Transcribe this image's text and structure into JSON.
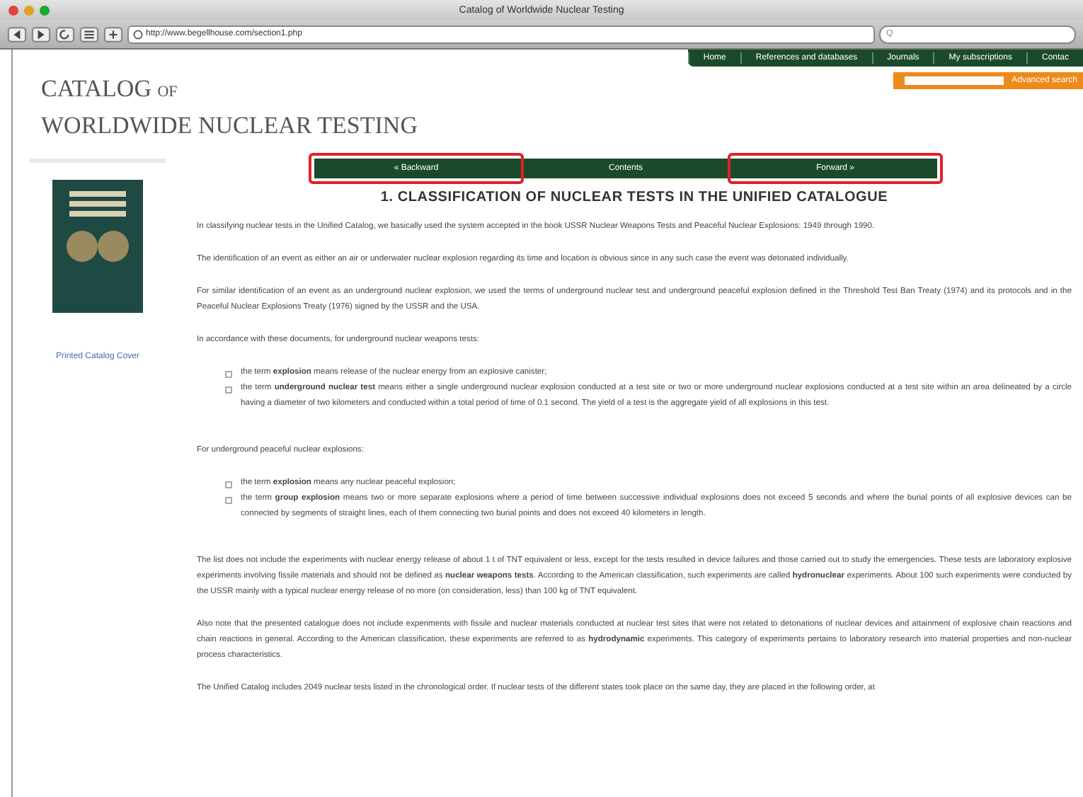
{
  "window": {
    "title": "Catalog of Worldwide Nuclear Testing"
  },
  "address_bar": {
    "value": "http://www.begellhouse.com/section1.php"
  },
  "search_bar": {
    "placeholder": "Q"
  },
  "top_nav": [
    {
      "label": "Home"
    },
    {
      "label": "References and databases"
    },
    {
      "label": "Journals"
    },
    {
      "label": "My subscriptions"
    },
    {
      "label": "Contac"
    }
  ],
  "site_search": {
    "button": "Advanced search"
  },
  "logo": {
    "line1": "CATALOG",
    "small": "OF",
    "line2": "WORLDWIDE NUCLEAR TESTING"
  },
  "sidebar": {
    "cover_link": "Printed Catalog Cover"
  },
  "pager": [
    {
      "label": "« Backward",
      "highlighted": true
    },
    {
      "label": "Contents",
      "highlighted": false
    },
    {
      "label": "Forward »",
      "highlighted": true
    }
  ],
  "heading": "1. CLASSIFICATION OF NUCLEAR TESTS IN THE UNIFIED CATALOGUE",
  "content": [
    {
      "kind": "paragraph",
      "text": "In classifying nuclear tests in the Unified Catalog, we basically used the system accepted in the book USSR Nuclear Weapons Tests and Peaceful Nuclear Explosions: 1949 through 1990."
    },
    {
      "kind": "paragraph",
      "text": "The identification of an event as either an air or underwater nuclear explosion regarding its time and location is obvious since in any such case the event was detonated individually."
    },
    {
      "kind": "paragraph",
      "text": "For similar identification of an event as an underground nuclear explosion, we used the terms of underground nuclear test and underground peaceful explosion defined in the Threshold Test Ban Treaty (1974) and its protocols and in the Peaceful Nuclear Explosions Treaty (1976) signed by the USSR and the USA."
    },
    {
      "kind": "paragraph",
      "text": "In accordance with these documents, for underground nuclear weapons tests:"
    },
    {
      "kind": "list",
      "items": [
        "the term **explosion** means release of the nuclear energy from an explosive canister;",
        "the term **underground nuclear test** means either a single underground nuclear explosion conducted at a test site or two or more underground nuclear explosions conducted at a test site within an area delineated by a circle having a diameter of two kilometers and conducted within a total period of time of 0.1 second. The yield of a test is the aggregate yield of all explosions in this test."
      ]
    },
    {
      "kind": "paragraph",
      "text": "For underground peaceful nuclear explosions:"
    },
    {
      "kind": "list",
      "items": [
        "the term **explosion** means any nuclear peaceful explosion;",
        "the term **group explosion** means two or more separate explosions where a period of time between successive individual explosions does not exceed 5 seconds and where the burial points of all explosive devices can be connected by segments of straight lines, each of them connecting two burial points and does not exceed 40 kilometers in length."
      ]
    },
    {
      "kind": "paragraph",
      "text": "The list does not include the experiments with nuclear energy release of about 1 t of TNT equivalent or less, except for the tests resulted in device failures and those carried out to study the emergencies. These tests are laboratory explosive experiments involving fissile materials and should not be defined as **nuclear weapons tests**. According to the American classification, such experiments are called **hydronuclear** experiments. About 100 such experiments were conducted by the USSR mainly with a typical nuclear energy release of no more (on consideration, less) than 100 kg of TNT equivalent."
    },
    {
      "kind": "paragraph",
      "text": "Also note that the presented catalogue does not include experiments with fissile and nuclear materials conducted at nuclear test sites that were not related to detonations of nuclear devices and attainment of explosive chain reactions and chain reactions in general. According to the American classification, these experiments are referred to as **hydrodynamic** experiments. This category of experiments pertains to laboratory research into material properties and non-nuclear process characteristics."
    },
    {
      "kind": "paragraph",
      "text": "The Unified Catalog includes 2049 nuclear tests listed in the chronological order. If nuclear tests of the different states took place on the same day, they are placed in the following order, at"
    }
  ]
}
